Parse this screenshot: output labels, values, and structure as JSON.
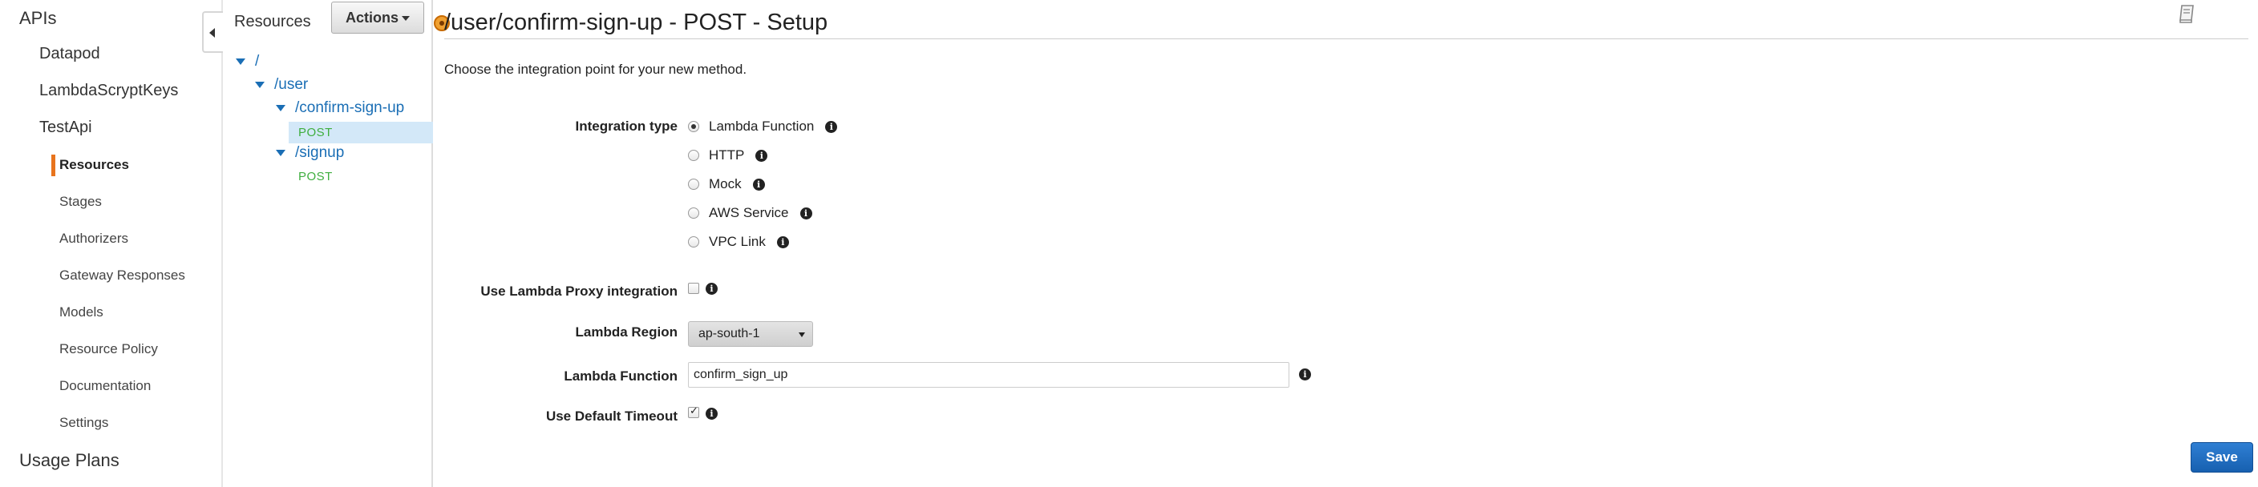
{
  "nav": {
    "apis": "APIs",
    "apis_list": [
      "Datapod",
      "LambdaScryptKeys",
      "TestApi"
    ],
    "testapi_items": [
      "Resources",
      "Stages",
      "Authorizers",
      "Gateway Responses",
      "Models",
      "Resource Policy",
      "Documentation",
      "Settings"
    ],
    "usage_plans": "Usage Plans"
  },
  "tree": {
    "title": "Resources",
    "actions_label": "Actions",
    "root": "/",
    "user": "/user",
    "confirm": "/confirm-sign-up",
    "confirm_method": "POST",
    "signup": "/signup",
    "signup_method": "POST"
  },
  "main": {
    "title": "/user/confirm-sign-up - POST - Setup",
    "intro": "Choose the integration point for your new method.",
    "integration_type_label": "Integration type",
    "integration_types": [
      "Lambda Function",
      "HTTP",
      "Mock",
      "AWS Service",
      "VPC Link"
    ],
    "selected_integration": "Lambda Function",
    "proxy_label": "Use Lambda Proxy integration",
    "proxy_checked": false,
    "region_label": "Lambda Region",
    "region_value": "ap-south-1",
    "function_label": "Lambda Function",
    "function_value": "confirm_sign_up",
    "timeout_label": "Use Default Timeout",
    "timeout_checked": true,
    "save_label": "Save"
  },
  "colors": {
    "accent": "#e8741d",
    "link": "#1a6eb5",
    "method": "#3fae3f",
    "save": "#1f6fc5",
    "selected": "#d3e8f8"
  }
}
